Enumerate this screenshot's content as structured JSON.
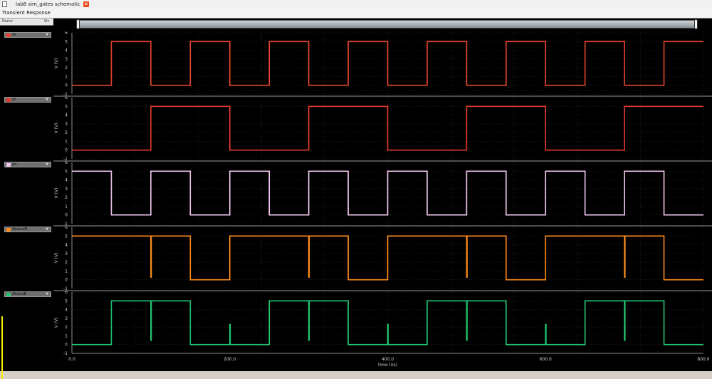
{
  "tabbar": {
    "tab_label": "lab8 sim_gates schematic"
  },
  "window": {
    "title": "Transient Response"
  },
  "left_panel": {
    "name_header": "Name",
    "vis_header": "Vis"
  },
  "signals": [
    {
      "name": "/A",
      "color": "#e8452c",
      "vis": "▼"
    },
    {
      "name": "/B",
      "color": "#e23a2a",
      "vis": "▼"
    },
    {
      "name": "/in",
      "color": "#f2c8f0",
      "vis": "▼"
    },
    {
      "name": "/AnandB",
      "color": "#ff8c1a",
      "vis": "▼"
    },
    {
      "name": "/AnordB",
      "color": "#22c773",
      "vis": "▼"
    }
  ],
  "chart_data": {
    "type": "line",
    "title": "Transient Response",
    "xlabel": "time (ns)",
    "ylabel": "V (V)",
    "xlim": [
      0,
      800
    ],
    "ylim": [
      -1,
      6
    ],
    "x_ticks": [
      0,
      200,
      400,
      600,
      800
    ],
    "x_tick_labels": [
      "0.0",
      "200.0",
      "400.0",
      "600.0",
      "800.0"
    ],
    "y_ticks": [
      -1,
      0,
      1,
      2,
      3,
      4,
      5,
      6
    ],
    "grid": true,
    "series": [
      {
        "name": "/A",
        "color": "#e8452c",
        "x": [
          0,
          50,
          50,
          100,
          100,
          150,
          150,
          200,
          200,
          250,
          250,
          300,
          300,
          350,
          350,
          400,
          400,
          450,
          450,
          500,
          500,
          550,
          550,
          600,
          600,
          650,
          650,
          700,
          700,
          750,
          750,
          800
        ],
        "y": [
          0,
          0,
          5,
          5,
          0,
          0,
          5,
          5,
          0,
          0,
          5,
          5,
          0,
          0,
          5,
          5,
          0,
          0,
          5,
          5,
          0,
          0,
          5,
          5,
          0,
          0,
          5,
          5,
          0,
          0,
          5,
          5
        ]
      },
      {
        "name": "/B",
        "color": "#e23a2a",
        "x": [
          0,
          100,
          100,
          200,
          200,
          300,
          300,
          400,
          400,
          500,
          500,
          600,
          600,
          700,
          700,
          800
        ],
        "y": [
          0,
          0,
          5,
          5,
          0,
          0,
          5,
          5,
          0,
          0,
          5,
          5,
          0,
          0,
          5,
          5
        ]
      },
      {
        "name": "/in",
        "color": "#f2c8f0",
        "x": [
          0,
          50,
          50,
          100,
          100,
          150,
          150,
          200,
          200,
          250,
          250,
          300,
          300,
          350,
          350,
          400,
          400,
          450,
          450,
          500,
          500,
          550,
          550,
          600,
          600,
          650,
          650,
          700,
          700,
          750,
          750,
          800
        ],
        "y": [
          5,
          5,
          0,
          0,
          5,
          5,
          0,
          0,
          5,
          5,
          0,
          0,
          5,
          5,
          0,
          0,
          5,
          5,
          0,
          0,
          5,
          5,
          0,
          0,
          5,
          5,
          0,
          0,
          5,
          5,
          0,
          0
        ]
      },
      {
        "name": "/AnandB",
        "color": "#ff8c1a",
        "x": [
          0,
          100,
          100,
          100.6,
          100.6,
          150,
          150,
          200,
          200,
          300,
          300,
          300.6,
          300.6,
          350,
          350,
          400,
          400,
          500,
          500,
          500.6,
          500.6,
          550,
          550,
          600,
          600,
          700,
          700,
          700.6,
          700.6,
          750,
          750,
          800
        ],
        "y": [
          5,
          5,
          0.3,
          0.3,
          5,
          5,
          0,
          0,
          5,
          5,
          0.3,
          0.3,
          5,
          5,
          0,
          0,
          5,
          5,
          0.3,
          0.3,
          5,
          5,
          0,
          0,
          5,
          5,
          0.3,
          0.3,
          5,
          5,
          0,
          0
        ]
      },
      {
        "name": "/AnordB",
        "color": "#22c773",
        "x": [
          0,
          50,
          50,
          100,
          100,
          100.6,
          100.6,
          150,
          150,
          200,
          200,
          200.6,
          200.6,
          250,
          250,
          300,
          300,
          300.6,
          300.6,
          350,
          350,
          400,
          400,
          400.6,
          400.6,
          450,
          450,
          500,
          500,
          500.6,
          500.6,
          550,
          550,
          600,
          600,
          600.6,
          600.6,
          650,
          650,
          700,
          700,
          700.6,
          700.6,
          750,
          750,
          800
        ],
        "y": [
          0,
          0,
          5,
          5,
          0.5,
          0.5,
          5,
          5,
          0,
          0,
          2.3,
          2.3,
          0,
          0,
          5,
          5,
          0.5,
          0.5,
          5,
          5,
          0,
          0,
          2.3,
          2.3,
          0,
          0,
          5,
          5,
          0.5,
          0.5,
          5,
          5,
          0,
          0,
          2.3,
          2.3,
          0,
          0,
          5,
          5,
          0.5,
          0.5,
          5,
          5,
          0,
          0
        ]
      }
    ]
  }
}
